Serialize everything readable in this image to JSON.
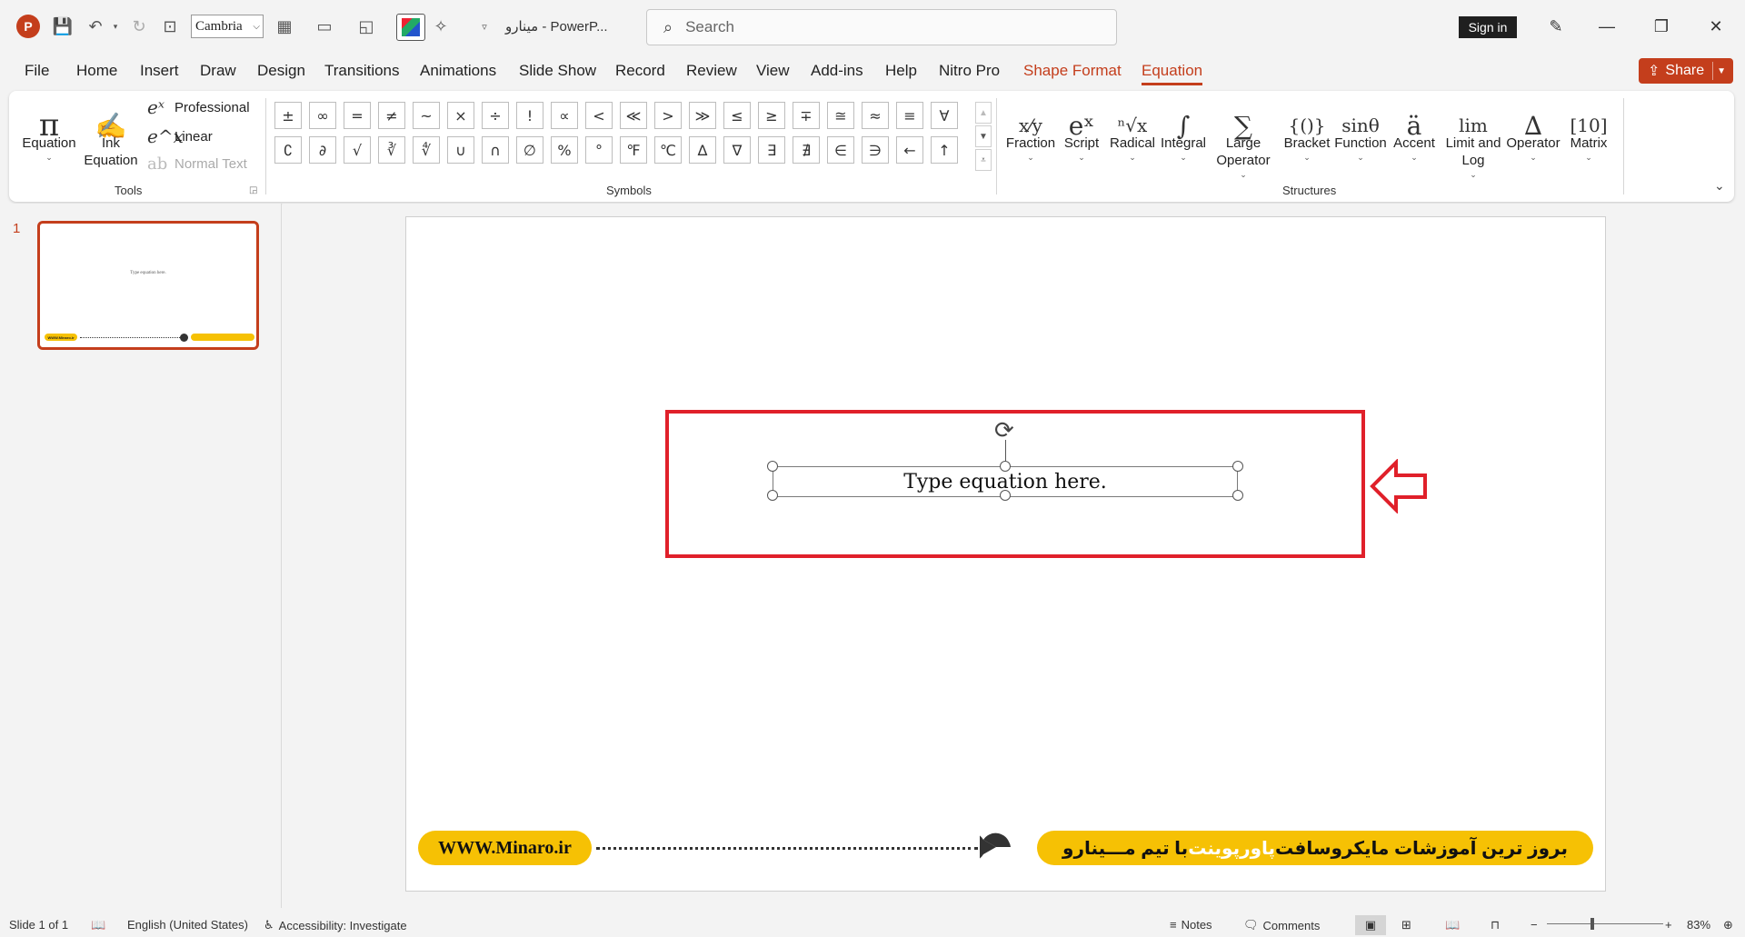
{
  "titlebar": {
    "font_name": "Cambria",
    "doc_title": "مینارو  -  PowerP...",
    "search_placeholder": "Search",
    "sign_in": "Sign in"
  },
  "tabs": [
    "File",
    "Home",
    "Insert",
    "Draw",
    "Design",
    "Transitions",
    "Animations",
    "Slide Show",
    "Record",
    "Review",
    "View",
    "Add-ins",
    "Help",
    "Nitro Pro",
    "Shape Format",
    "Equation"
  ],
  "share_label": "Share",
  "ribbon": {
    "tools": {
      "equation": "Equation",
      "ink_line1": "Ink",
      "ink_line2": "Equation",
      "professional": "Professional",
      "linear": "Linear",
      "normal_text": "Normal Text",
      "label": "Tools"
    },
    "symbols": {
      "row1": [
        "±",
        "∞",
        "=",
        "≠",
        "~",
        "×",
        "÷",
        "!",
        "∝",
        "<",
        "≪",
        ">",
        "≫",
        "≤",
        "≥",
        "∓",
        "≅",
        "≈",
        "≡",
        "∀"
      ],
      "row2": [
        "∁",
        "∂",
        "√",
        "∛",
        "∜",
        "∪",
        "∩",
        "∅",
        "%",
        "°",
        "℉",
        "℃",
        "∆",
        "∇",
        "∃",
        "∄",
        "∈",
        "∋",
        "←",
        "↑"
      ],
      "label": "Symbols"
    },
    "structures": {
      "items": [
        {
          "glyph": "x⁄y",
          "l1": "Fraction",
          "l2": ""
        },
        {
          "glyph": "eˣ",
          "l1": "Script",
          "l2": ""
        },
        {
          "glyph": "ⁿ√x",
          "l1": "Radical",
          "l2": ""
        },
        {
          "glyph": "∫",
          "l1": "Integral",
          "l2": ""
        },
        {
          "glyph": "∑",
          "l1": "Large",
          "l2": "Operator"
        },
        {
          "glyph": "{()}",
          "l1": "Bracket",
          "l2": ""
        },
        {
          "glyph": "sinθ",
          "l1": "Function",
          "l2": ""
        },
        {
          "glyph": "ä",
          "l1": "Accent",
          "l2": ""
        },
        {
          "glyph": "lim",
          "l1": "Limit and",
          "l2": "Log"
        },
        {
          "glyph": "∆",
          "l1": "Operator",
          "l2": ""
        },
        {
          "glyph": "[10]",
          "l1": "Matrix",
          "l2": ""
        }
      ],
      "label": "Structures"
    }
  },
  "thumbnail": {
    "number": "1",
    "text": "Type equation here.",
    "pill_text": "WWW.Minaro.ir"
  },
  "slide": {
    "equation_placeholder": "Type equation here.",
    "website": "WWW.Minaro.ir",
    "banner_before": "بروز ترین آموزشات مایکروسافت ",
    "banner_highlight": "پاورپوینت",
    "banner_after": " با تیم مـــینارو"
  },
  "statusbar": {
    "slide_info": "Slide 1 of 1",
    "language": "English (United States)",
    "accessibility": "Accessibility: Investigate",
    "notes": "Notes",
    "comments": "Comments",
    "zoom": "83%"
  },
  "colors": {
    "accent": "#c43e1c",
    "highlight_box": "#e0202a",
    "banner_yellow": "#f6c104"
  }
}
